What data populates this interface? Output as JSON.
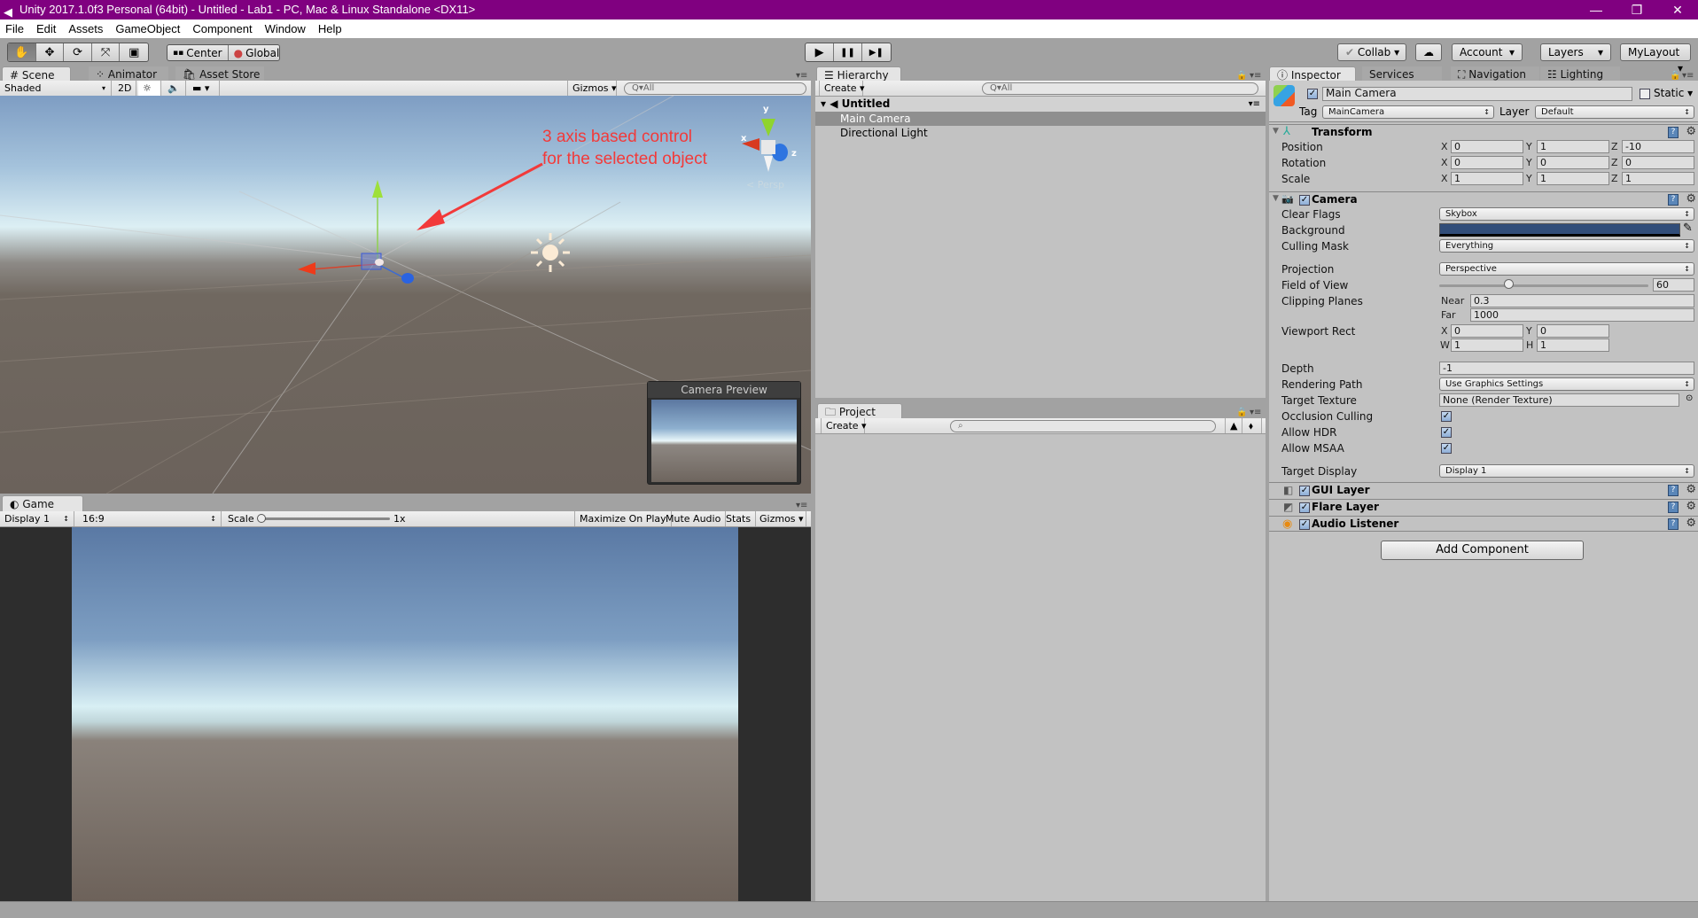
{
  "window": {
    "title": "Unity 2017.1.0f3 Personal (64bit) - Untitled - Lab1 - PC, Mac & Linux Standalone <DX11>",
    "controls": {
      "minimize": "—",
      "maximize": "❐",
      "close": "✕"
    }
  },
  "menu": [
    "File",
    "Edit",
    "Assets",
    "GameObject",
    "Component",
    "Window",
    "Help"
  ],
  "toolbar": {
    "tools": [
      "hand-tool",
      "move-tool",
      "rotate-tool",
      "scale-tool",
      "rect-tool"
    ],
    "active_tool": "hand-tool",
    "pivot_mode": "Center",
    "pivot_rotation": "Global",
    "play": "▶",
    "pause": "❚❚",
    "step": "▶❚",
    "collab": "Collab",
    "account": "Account",
    "layers": "Layers",
    "layout": "MyLayout"
  },
  "scene_panel": {
    "tabs": [
      "Scene",
      "Animator",
      "Asset Store"
    ],
    "active_tab": "Scene",
    "draw_mode": "Shaded",
    "toggle_2d": "2D",
    "gizmos": "Gizmos",
    "search_placeholder": "All",
    "annotation": [
      "3 axis based control",
      "for the selected object"
    ],
    "persp_label": "Persp",
    "axis_labels": {
      "x": "x",
      "y": "y",
      "z": "z"
    },
    "camera_preview_title": "Camera Preview"
  },
  "game_panel": {
    "tab": "Game",
    "display": "Display 1",
    "aspect": "16:9",
    "scale_label": "Scale",
    "scale_value": "1x",
    "scale_fraction": 0.0,
    "buttons": [
      "Maximize On Play",
      "Mute Audio",
      "Stats",
      "Gizmos"
    ]
  },
  "hierarchy": {
    "tab": "Hierarchy",
    "create": "Create",
    "search_placeholder": "All",
    "scene_name": "Untitled",
    "items": [
      {
        "label": "Main Camera",
        "selected": true
      },
      {
        "label": "Directional Light",
        "selected": false
      }
    ]
  },
  "project": {
    "tab": "Project",
    "create": "Create",
    "search_placeholder": ""
  },
  "inspector": {
    "tabs": [
      "Inspector",
      "Services",
      "Navigation",
      "Lighting"
    ],
    "active_tab": "Inspector",
    "object_name": "Main Camera",
    "active": true,
    "static_label": "Static",
    "static": false,
    "tag_label": "Tag",
    "tag": "MainCamera",
    "layer_label": "Layer",
    "layer": "Default",
    "transform": {
      "title": "Transform",
      "rows": [
        {
          "label": "Position",
          "x": "0",
          "y": "1",
          "z": "-10"
        },
        {
          "label": "Rotation",
          "x": "0",
          "y": "0",
          "z": "0"
        },
        {
          "label": "Scale",
          "x": "1",
          "y": "1",
          "z": "1"
        }
      ]
    },
    "camera": {
      "title": "Camera",
      "enabled": true,
      "clear_flags_label": "Clear Flags",
      "clear_flags": "Skybox",
      "background_label": "Background",
      "background_color": "#314d79",
      "culling_mask_label": "Culling Mask",
      "culling_mask": "Everything",
      "projection_label": "Projection",
      "projection": "Perspective",
      "fov_label": "Field of View",
      "fov": "60",
      "fov_fraction": 0.33,
      "clipping_label": "Clipping Planes",
      "near_label": "Near",
      "near": "0.3",
      "far_label": "Far",
      "far": "1000",
      "viewport_label": "Viewport Rect",
      "viewport": {
        "x": "0",
        "y": "0",
        "w": "1",
        "h": "1"
      },
      "depth_label": "Depth",
      "depth": "-1",
      "rendering_path_label": "Rendering Path",
      "rendering_path": "Use Graphics Settings",
      "target_texture_label": "Target Texture",
      "target_texture": "None (Render Texture)",
      "occlusion_label": "Occlusion Culling",
      "occlusion": true,
      "hdr_label": "Allow HDR",
      "hdr": true,
      "msaa_label": "Allow MSAA",
      "msaa": true,
      "target_display_label": "Target Display",
      "target_display": "Display 1"
    },
    "components": [
      {
        "title": "GUI Layer",
        "enabled": true
      },
      {
        "title": "Flare Layer",
        "enabled": true
      },
      {
        "title": "Audio Listener",
        "enabled": true
      }
    ],
    "add_component": "Add Component"
  },
  "colors": {
    "title_bar": "#800080",
    "annotation": "#f23a3a",
    "selection": "#8f8f8f"
  }
}
